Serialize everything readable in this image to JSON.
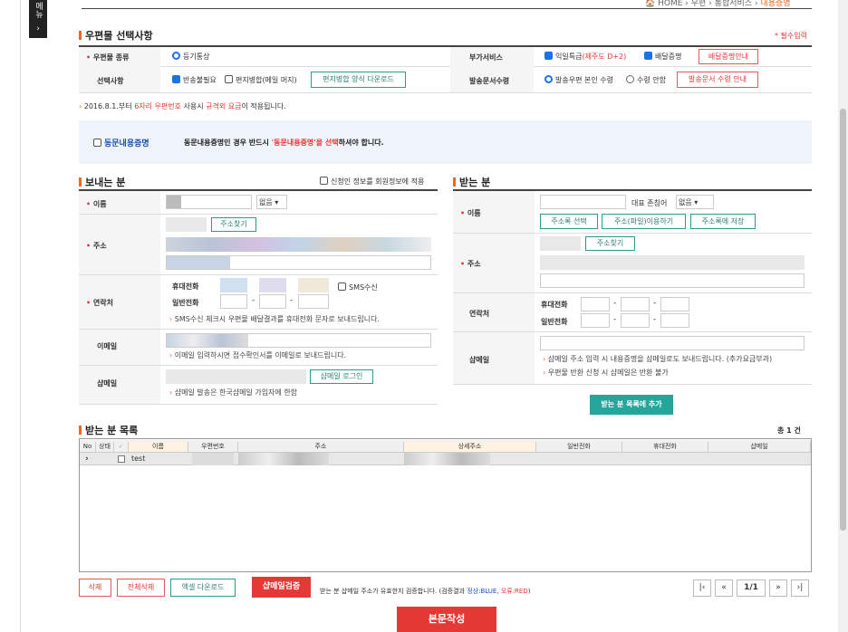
{
  "menu_tab": "메뉴",
  "breadcrumb": {
    "home": "HOME",
    "path": [
      "우편",
      "통합서비스",
      "내용증명"
    ],
    "sep": "›"
  },
  "postal_section": {
    "title": "우편물 선택사항",
    "required_note": "* 필수입력",
    "mail_type_label": "우편물 종류",
    "mail_type_value": "등기통상",
    "extra_label": "부가서비스",
    "extra_express": "익일특급",
    "extra_jeju": "(제주도 D+2)",
    "extra_delivery": "배달증명",
    "extra_delivery_btn": "배달증명안내",
    "options_label": "선택사항",
    "opt_no_return": "반송불필요",
    "opt_merge": "편지병합(메일 머지)",
    "merge_btn": "편지병합 양식 다운로드",
    "receipt_label": "발송문서수령",
    "receipt_self": "발송우편 본인 수령",
    "receipt_no": "수령 안함",
    "receipt_btn": "발송문서 수령 안내"
  },
  "notice": {
    "prefix": "2016.8.1.부터 ",
    "highlight1": "6자리 우편번호",
    "mid": " 사용시 ",
    "highlight2": "규격외 요금",
    "suffix": "이 적용됩니다."
  },
  "same_content": {
    "label": "동문내용증명",
    "text1": "동문내용증명인 경우 반드시 ",
    "text_hl": "'동문내용증명'을 선택",
    "text2": "하셔야 합니다."
  },
  "sender": {
    "title": "보내는 분",
    "apply_member": "신청인 정보를 회원정보에 적용",
    "name_label": "이름",
    "name_honorific": "없음",
    "addr_label": "주소",
    "addr_btn": "주소찾기",
    "contact_label": "연락처",
    "mobile_label": "휴대전화",
    "phone_label": "일반전화",
    "sms_label": "SMS수신",
    "sms_note": "SMS수신 체크시 우편물 배달결과를 휴대전화 문자로 보내드립니다.",
    "email_label": "이메일",
    "email_note": "이메일 입력하시면 접수확인서를 이메일로 보내드립니다.",
    "shmail_label": "샵메일",
    "shmail_btn": "샵메일 로그인",
    "shmail_note": "샵메일 발송은 한국샵메일 가입자에 한함"
  },
  "receiver": {
    "title": "받는 분",
    "name_label": "이름",
    "rep_honorific_label": "대표 존칭어",
    "rep_honorific": "없음",
    "btn_addr_select": "주소록 선택",
    "btn_file": "주소(파일)이용하기",
    "btn_save": "주소록에 저장",
    "addr_label": "주소",
    "addr_btn": "주소찾기",
    "contact_label": "연락처",
    "mobile_label": "휴대전화",
    "phone_label": "일반전화",
    "shmail_label": "샵메일",
    "shmail_note1": "샵메일 주소 입력 시 내용증명을 샵메일로도 보내드립니다. (추가요금부과)",
    "shmail_note2": "우편물 반환 신청 시 샵메일은 반환 불가",
    "add_btn": "받는 분 목록에 추가"
  },
  "list": {
    "title": "받는 분 목록",
    "count": "총 1 건",
    "columns": [
      "No",
      "상태",
      "",
      "이름",
      "우편번호",
      "주소",
      "상세주소",
      "일반전화",
      "휴대전화",
      "샵메일"
    ],
    "rows": [
      {
        "name": "test"
      }
    ]
  },
  "bottom": {
    "delete": "삭제",
    "delete_all": "전체삭제",
    "excel": "엑셀 다운로드",
    "verify": "샵메일검증",
    "verify_note1": "받는 분 샵메일 주소가 유효한지 검증합니다. (검증결과 ",
    "verify_blue": "정상:BLUE",
    "verify_comma": ", ",
    "verify_red": "오류:RED",
    "verify_close": ")",
    "page": "1/1",
    "write": "본문작성"
  },
  "colors": {
    "accent": "#f26522",
    "teal": "#2a9d8f",
    "red": "#e33",
    "blue": "#1a73e8"
  }
}
